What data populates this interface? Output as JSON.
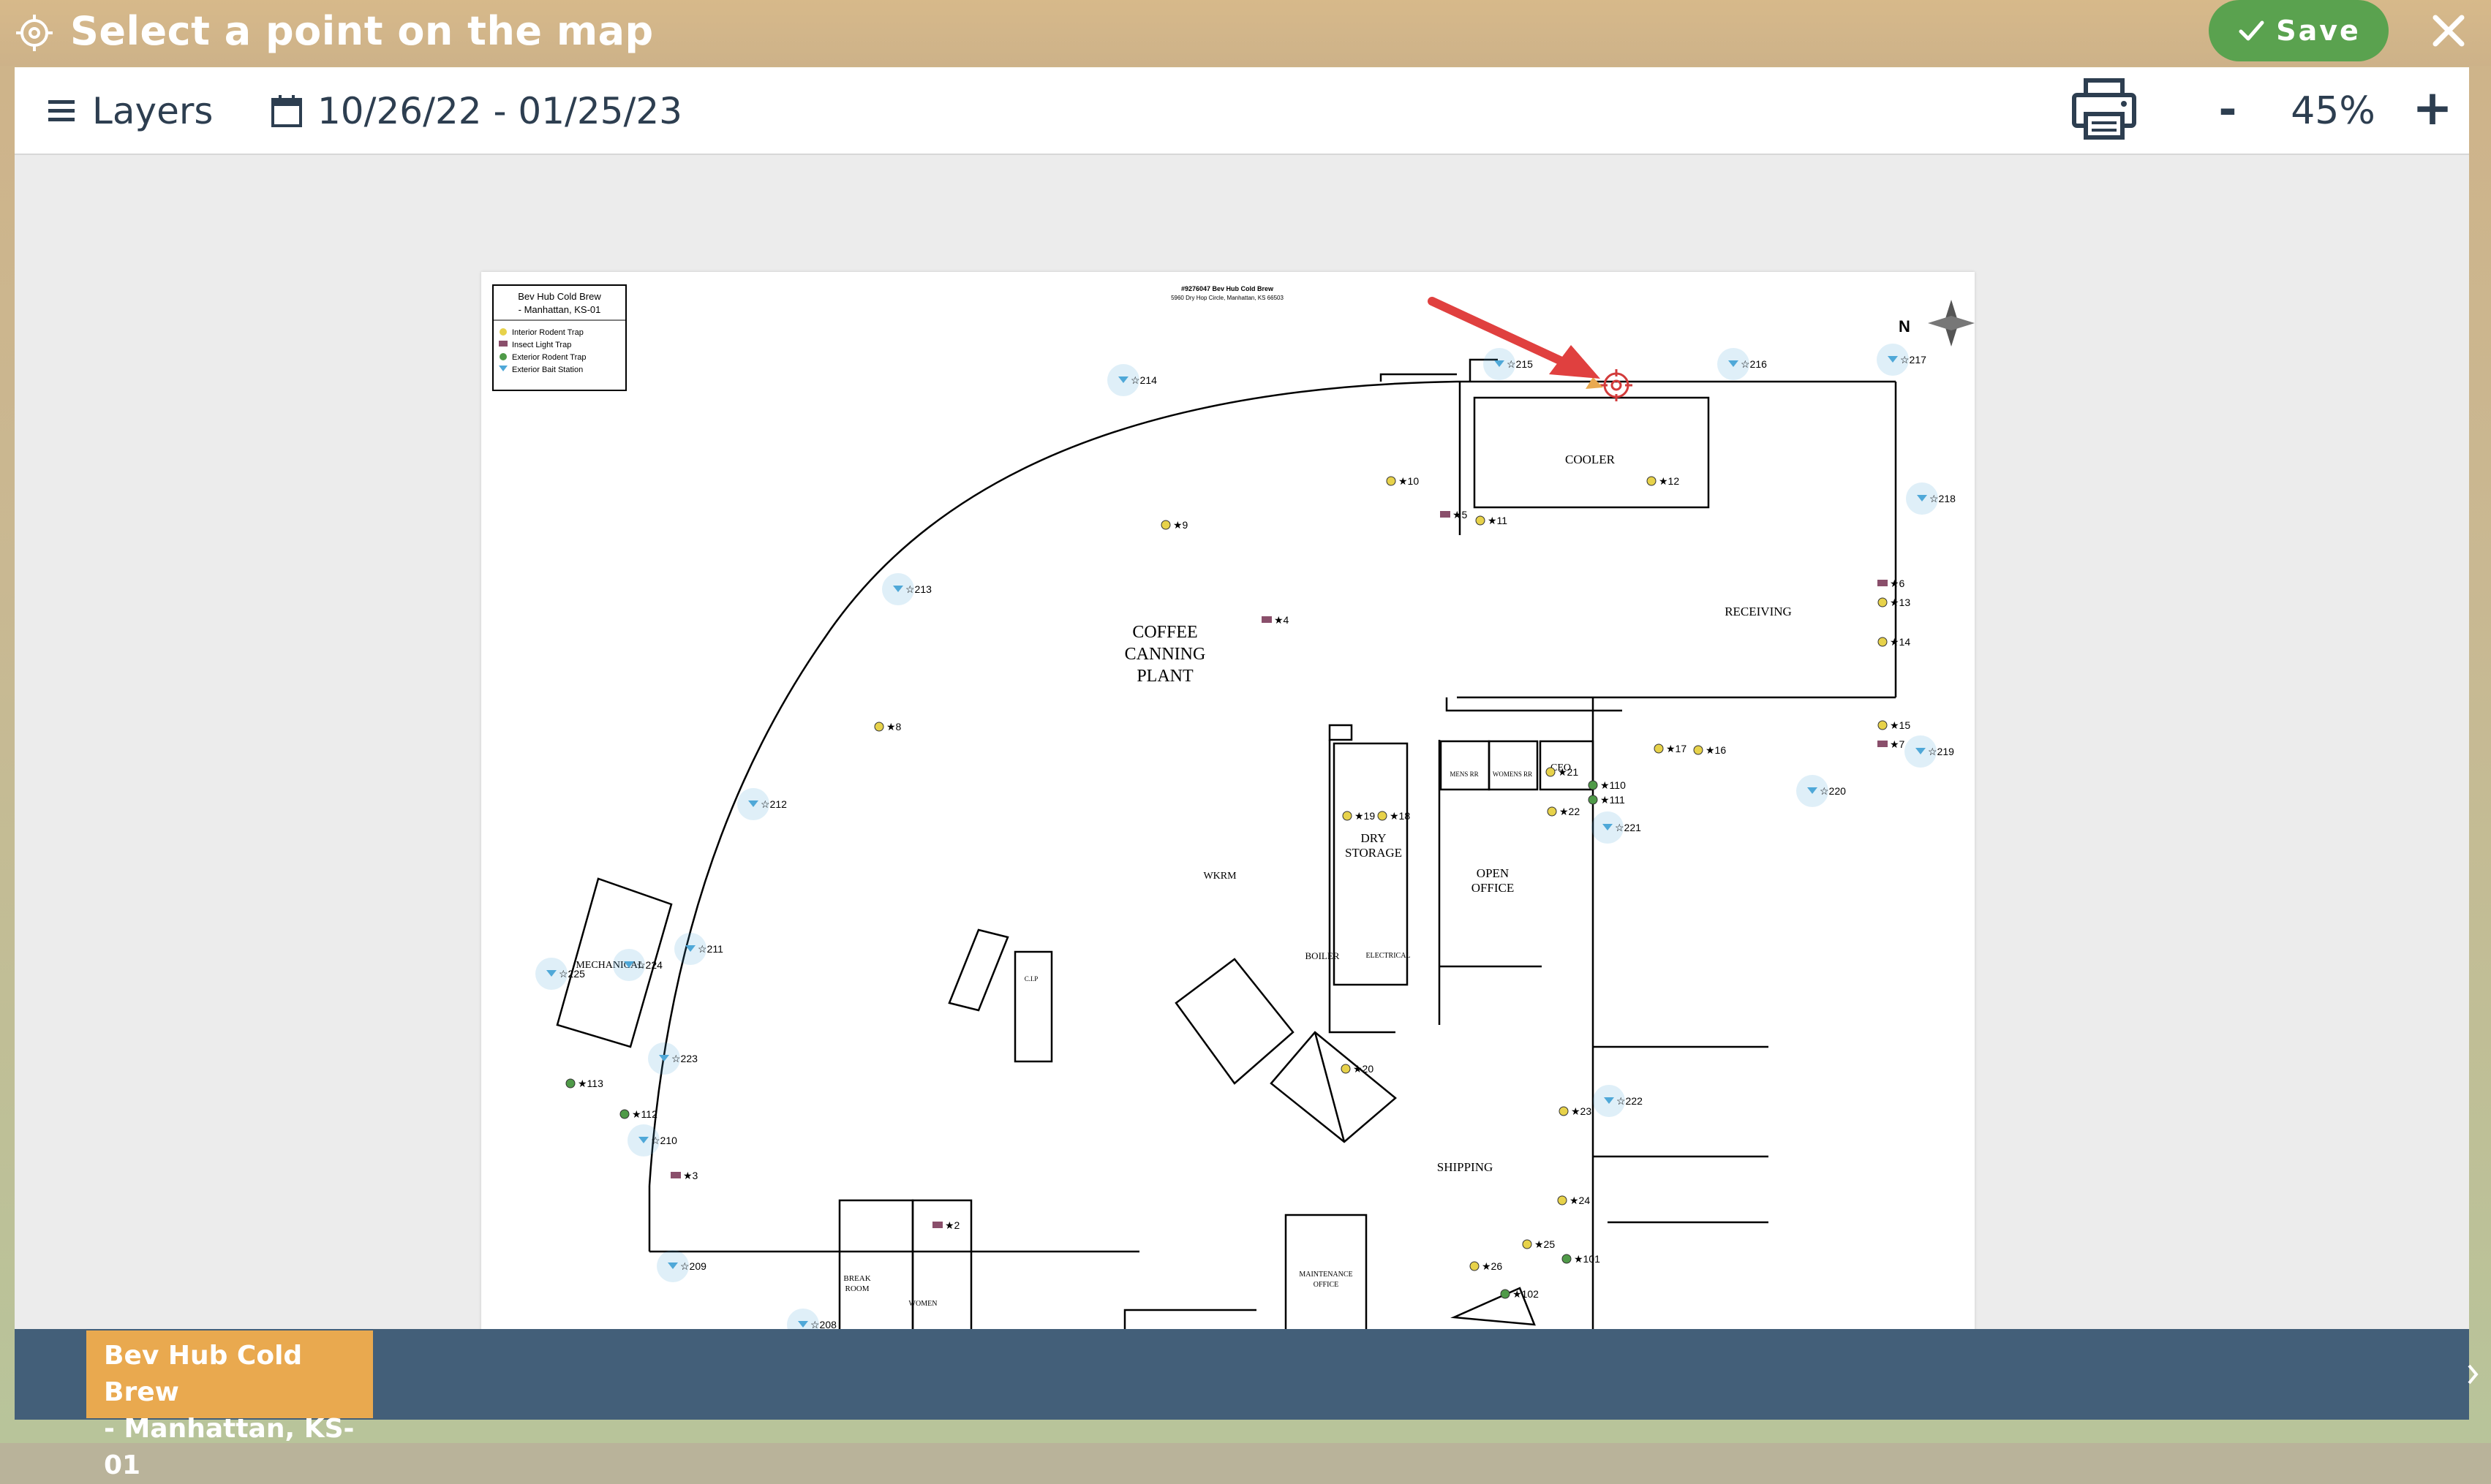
{
  "header": {
    "title": "Select a point on the map",
    "save_label": "Save"
  },
  "toolbar": {
    "layers_label": "Layers",
    "date_range": "10/26/22 - 01/25/23",
    "zoom_out_label": "-",
    "zoom_level": "45%",
    "zoom_in_label": "+"
  },
  "map": {
    "site_title_line1": "Bev Hub Cold Brew",
    "site_title_line2": "- Manhattan, KS-01",
    "header_line1": "#9276047 Bev Hub Cold Brew",
    "header_line2": "5960 Dry Hop Circle, Manhattan, KS 66503",
    "legend": [
      {
        "label": "Interior Rodent Trap",
        "color": "#e7d24a"
      },
      {
        "label": "Insect Light Trap",
        "color": "#8a4f6b"
      },
      {
        "label": "Exterior Rodent Trap",
        "color": "#4f9a48"
      },
      {
        "label": "Exterior Bait Station",
        "color": "#4fa8d8"
      }
    ],
    "rooms": {
      "cooler": "COOLER",
      "receiving": "RECEIVING",
      "plant_1": "COFFEE",
      "plant_2": "CANNING",
      "plant_3": "PLANT",
      "dry_storage_1": "DRY",
      "dry_storage_2": "STORAGE",
      "mens": "MENS RR",
      "womens": "WOMENS RR",
      "ceo": "CEO",
      "wkrm": "WKRM",
      "open_office_1": "OPEN",
      "open_office_2": "OFFICE",
      "boiler": "BOILER",
      "electrical": "ELECTRICAL",
      "mechanical": "MECHANICAL",
      "shipping": "SHIPPING",
      "break_room_1": "BREAK",
      "break_room_2": "ROOM",
      "women": "WOMEN",
      "maintenance_1": "MAINTENANCE",
      "maintenance_2": "OFFICE",
      "cip": "C.I.P"
    },
    "compass_label": "N",
    "devices": [
      {
        "id": "215",
        "type": "bait"
      },
      {
        "id": "216",
        "type": "bait"
      },
      {
        "id": "217",
        "type": "bait"
      },
      {
        "id": "218",
        "type": "bait"
      },
      {
        "id": "219",
        "type": "bait"
      },
      {
        "id": "220",
        "type": "bait"
      },
      {
        "id": "221",
        "type": "bait"
      },
      {
        "id": "222",
        "type": "bait"
      },
      {
        "id": "214",
        "type": "bait"
      },
      {
        "id": "213",
        "type": "bait"
      },
      {
        "id": "212",
        "type": "bait"
      },
      {
        "id": "211",
        "type": "bait"
      },
      {
        "id": "225",
        "type": "bait"
      },
      {
        "id": "224",
        "type": "bait"
      },
      {
        "id": "223",
        "type": "bait"
      },
      {
        "id": "210",
        "type": "bait"
      },
      {
        "id": "209",
        "type": "bait"
      },
      {
        "id": "208",
        "type": "bait"
      },
      {
        "id": "10",
        "type": "rodent"
      },
      {
        "id": "12",
        "type": "rodent"
      },
      {
        "id": "9",
        "type": "rodent"
      },
      {
        "id": "5",
        "type": "light"
      },
      {
        "id": "11",
        "type": "rodent"
      },
      {
        "id": "6",
        "type": "light"
      },
      {
        "id": "13",
        "type": "rodent"
      },
      {
        "id": "14",
        "type": "rodent"
      },
      {
        "id": "15",
        "type": "rodent"
      },
      {
        "id": "7",
        "type": "light"
      },
      {
        "id": "17",
        "type": "rodent"
      },
      {
        "id": "16",
        "type": "rodent"
      },
      {
        "id": "4",
        "type": "light"
      },
      {
        "id": "8",
        "type": "rodent"
      },
      {
        "id": "21",
        "type": "rodent"
      },
      {
        "id": "110",
        "type": "exterior"
      },
      {
        "id": "111",
        "type": "exterior"
      },
      {
        "id": "22",
        "type": "rodent"
      },
      {
        "id": "19",
        "type": "rodent"
      },
      {
        "id": "18",
        "type": "rodent"
      },
      {
        "id": "2",
        "type": "light"
      },
      {
        "id": "3",
        "type": "light"
      },
      {
        "id": "113",
        "type": "exterior"
      },
      {
        "id": "112",
        "type": "exterior"
      },
      {
        "id": "20",
        "type": "rodent"
      },
      {
        "id": "23",
        "type": "rodent"
      },
      {
        "id": "24",
        "type": "rodent"
      },
      {
        "id": "25",
        "type": "rodent"
      },
      {
        "id": "26",
        "type": "rodent"
      },
      {
        "id": "101",
        "type": "exterior"
      },
      {
        "id": "102",
        "type": "exterior"
      }
    ]
  },
  "footer": {
    "site_line1": "Bev Hub Cold Brew",
    "site_line2": "- Manhattan, KS-01"
  },
  "colors": {
    "accent": "#5aa24f",
    "badge": "#e9a94f",
    "bar": "#435f79",
    "arrow": "#e0403f"
  }
}
